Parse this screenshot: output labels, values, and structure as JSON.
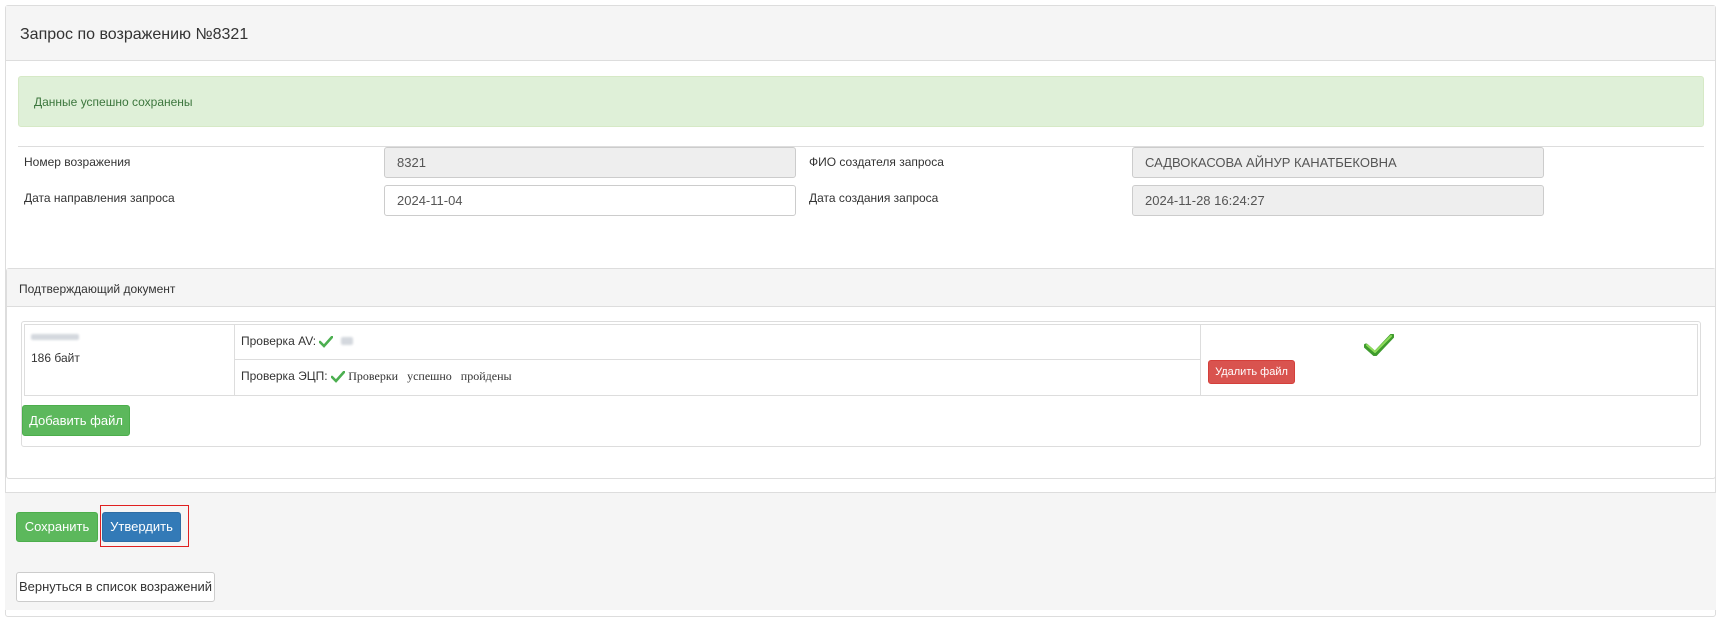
{
  "page": {
    "title": "Запрос по возражению №8321",
    "alert": "Данные успешно сохранены"
  },
  "form": {
    "objection_number_label": "Номер возражения",
    "objection_number_value": "8321",
    "creator_label": "ФИО создателя запроса",
    "creator_value": "САДВОКАСОВА АЙНУР КАНАТБЕКОВНА",
    "send_date_label": "Дата направления запроса",
    "send_date_value": "2024-11-04",
    "created_date_label": "Дата создания запроса",
    "created_date_value": "2024-11-28 16:24:27"
  },
  "document": {
    "heading": "Подтверждающий документ",
    "file_size": "186 байт",
    "av_check_label": "Проверка AV:",
    "eds_check_label": "Проверка ЭЦП:",
    "eds_check_result": "Проверки успешно пройдены",
    "delete_button": "Удалить файл",
    "add_button": "Добавить файл"
  },
  "footer": {
    "save_button": "Сохранить",
    "approve_button": "Утвердить",
    "back_button": "Вернуться в список возражений"
  },
  "colors": {
    "success": "#5cb85c",
    "primary": "#337ab7",
    "danger": "#d9534f",
    "alert_bg": "#dff0d8",
    "highlight": "#e02020"
  },
  "icons": {
    "check": "check-icon"
  }
}
